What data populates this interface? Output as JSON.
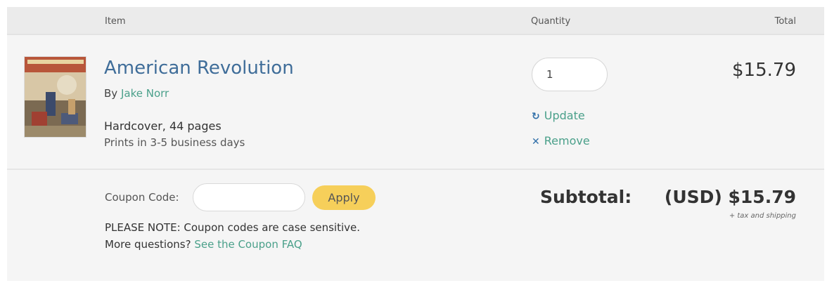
{
  "header": {
    "item_label": "Item",
    "quantity_label": "Quantity",
    "total_label": "Total"
  },
  "cart_item": {
    "title": "American Revolution",
    "by_prefix": "By",
    "author": "Jake Norr",
    "format": "Hardcover, 44 pages",
    "shipping_note": "Prints in 3-5 business days",
    "quantity": "1",
    "update_label": "Update",
    "remove_label": "Remove",
    "line_total": "$15.79",
    "thumbnail_icon": "book-cover-image"
  },
  "coupon": {
    "label": "Coupon Code:",
    "value": "",
    "apply_label": "Apply",
    "note": "PLEASE NOTE: Coupon codes are case sensitive.",
    "questions_prefix": "More questions?",
    "faq_link": "See the Coupon FAQ"
  },
  "summary": {
    "subtotal_label": "Subtotal:",
    "subtotal_value": "(USD) $15.79",
    "tax_note": "+ tax and shipping"
  },
  "colors": {
    "link": "#4aa08a",
    "title": "#3f6d99",
    "apply_button": "#f6cf5a",
    "icon_blue": "#2f6ea8"
  }
}
